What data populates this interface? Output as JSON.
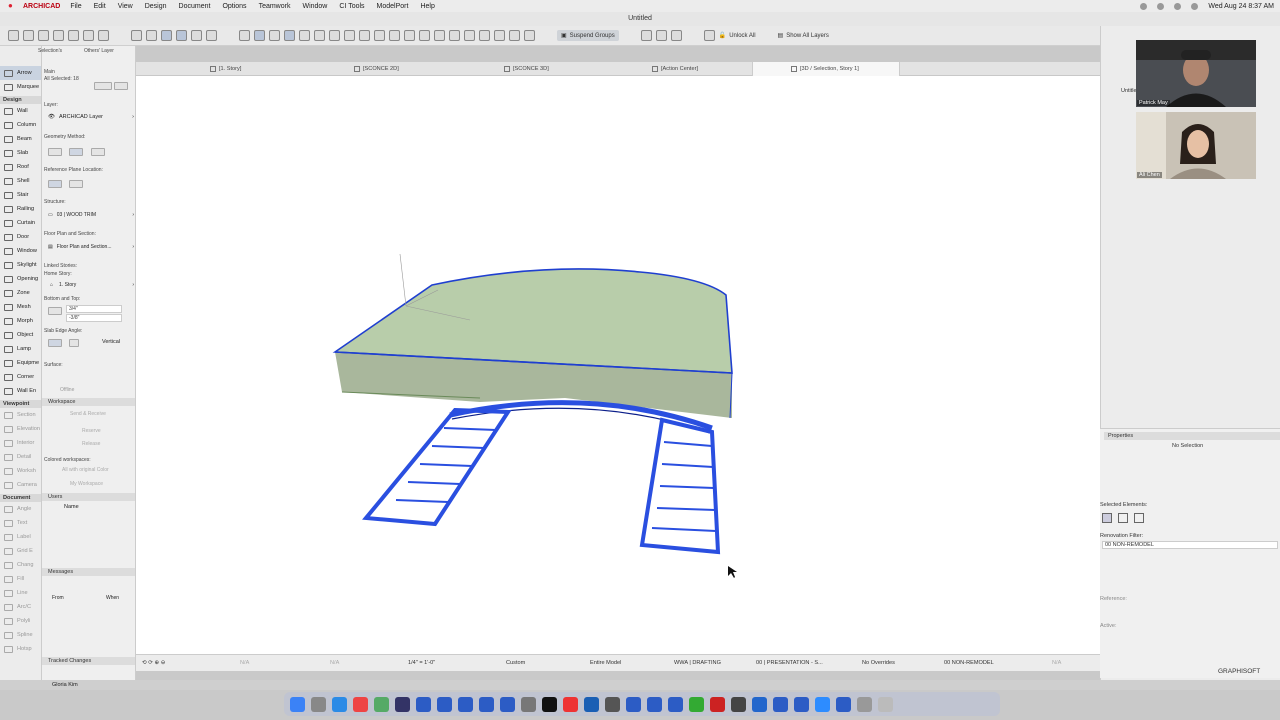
{
  "menubar": {
    "app": "ARCHICAD",
    "items": [
      "File",
      "Edit",
      "View",
      "Design",
      "Document",
      "Options",
      "Teamwork",
      "Window",
      "CI Tools",
      "ModelPort",
      "Help"
    ],
    "clock": "Wed Aug 24  8:37 AM"
  },
  "window": {
    "title": "Untitled"
  },
  "toolbar": {
    "suspend_groups": "Suspend Groups",
    "unlock_all": "Unlock All",
    "show_all_layers": "Show All Layers"
  },
  "toolbox": {
    "selection_header": "Selection's",
    "others_layer": "Others' Layer",
    "arrow": "Arrow",
    "marquee": "Marquee",
    "design_header": "Design",
    "design_tools": [
      "Wall",
      "Column",
      "Beam",
      "Slab",
      "Roof",
      "Shell",
      "Stair",
      "Railing",
      "Curtain",
      "Door",
      "Window",
      "Skylight",
      "Opening",
      "Zone",
      "Mesh",
      "Morph",
      "Object",
      "Lamp",
      "Equipme",
      "Corner",
      "Wall En"
    ],
    "viewpoint_header": "Viewpoint",
    "viewpoint_tools": [
      "Section",
      "Elevation",
      "Interior",
      "Detail",
      "Worksh",
      "Camera"
    ],
    "document_header": "Document",
    "document_tools": [
      "Angle",
      "Text",
      "Label",
      "Grid E",
      "Chang",
      "Fill",
      "Line",
      "Arc/C",
      "Polyli",
      "Spline",
      "Hotsp"
    ]
  },
  "info": {
    "main": "Main",
    "all_selected": "All Selected: 18",
    "layer_label": "Layer:",
    "layer_value": "ARCHICAD Layer",
    "geometry_method": "Geometry Method:",
    "reference_plane": "Reference Plane Location:",
    "structure": "Structure:",
    "structure_value": "03 | WOOD TRIM",
    "floor_plan_section": "Floor Plan and Section:",
    "floor_plan_value": "Floor Plan and Section...",
    "linked_stories": "Linked Stories:",
    "home_story": "Home Story:",
    "home_story_value": "1. Story",
    "bottom_top": "Bottom and Top:",
    "top_offset": "3/4\"",
    "bottom_offset": "-3/8\"",
    "slab_edge_angle": "Slab Edge Angle:",
    "vertical": "Vertical",
    "surface": "Surface:",
    "offline": "Offline",
    "workspace": "Workspace",
    "send_receive": "Send & Receive",
    "reserve": "Reserve",
    "release": "Release",
    "colored_workspaces": "Colored workspaces:",
    "all_original_color": "All with original Color",
    "my_workspace": "My Workspace",
    "users": "Users",
    "name": "Name",
    "messages": "Messages",
    "from": "From",
    "when": "When",
    "tracked_changes": "Tracked Changes"
  },
  "tabs": [
    {
      "label": "[1. Story]"
    },
    {
      "label": "[SCONCE 2D]"
    },
    {
      "label": "[SCONCE 3D]"
    },
    {
      "label": "[Action Center]"
    },
    {
      "label": "[3D / Selection, Story 1]"
    }
  ],
  "statusbar": {
    "na1": "N/A",
    "na2": "N/A",
    "scale": "1/4\" = 1'-0\"",
    "custom": "Custom",
    "entire_model": "Entire Model",
    "drafting": "WWA | DRAFTING",
    "presentation": "00 | PRESENTATION - S...",
    "overrides": "No Overrides",
    "remodel": "00 NON-REMODEL",
    "na3": "N/A"
  },
  "participants": [
    {
      "name": "Patrick May"
    },
    {
      "name": "Ali Chen"
    }
  ],
  "side_tab": "Untitle",
  "properties": {
    "header": "Properties",
    "no_selection": "No Selection",
    "selected_elements": "Selected Elements:",
    "renovation_filter": "Renovation Filter:",
    "renovation_value": "00 NON-REMODEL",
    "reference": "Reference:",
    "active": "Active:"
  },
  "graphisoft": "GRAPHISOFT",
  "taskbar": {
    "user": "Gloria Kim"
  },
  "colors": {
    "slab_fill": "#a9c49a",
    "edge_blue": "#1f3fd0",
    "stair_blue": "#2a4fe0"
  }
}
